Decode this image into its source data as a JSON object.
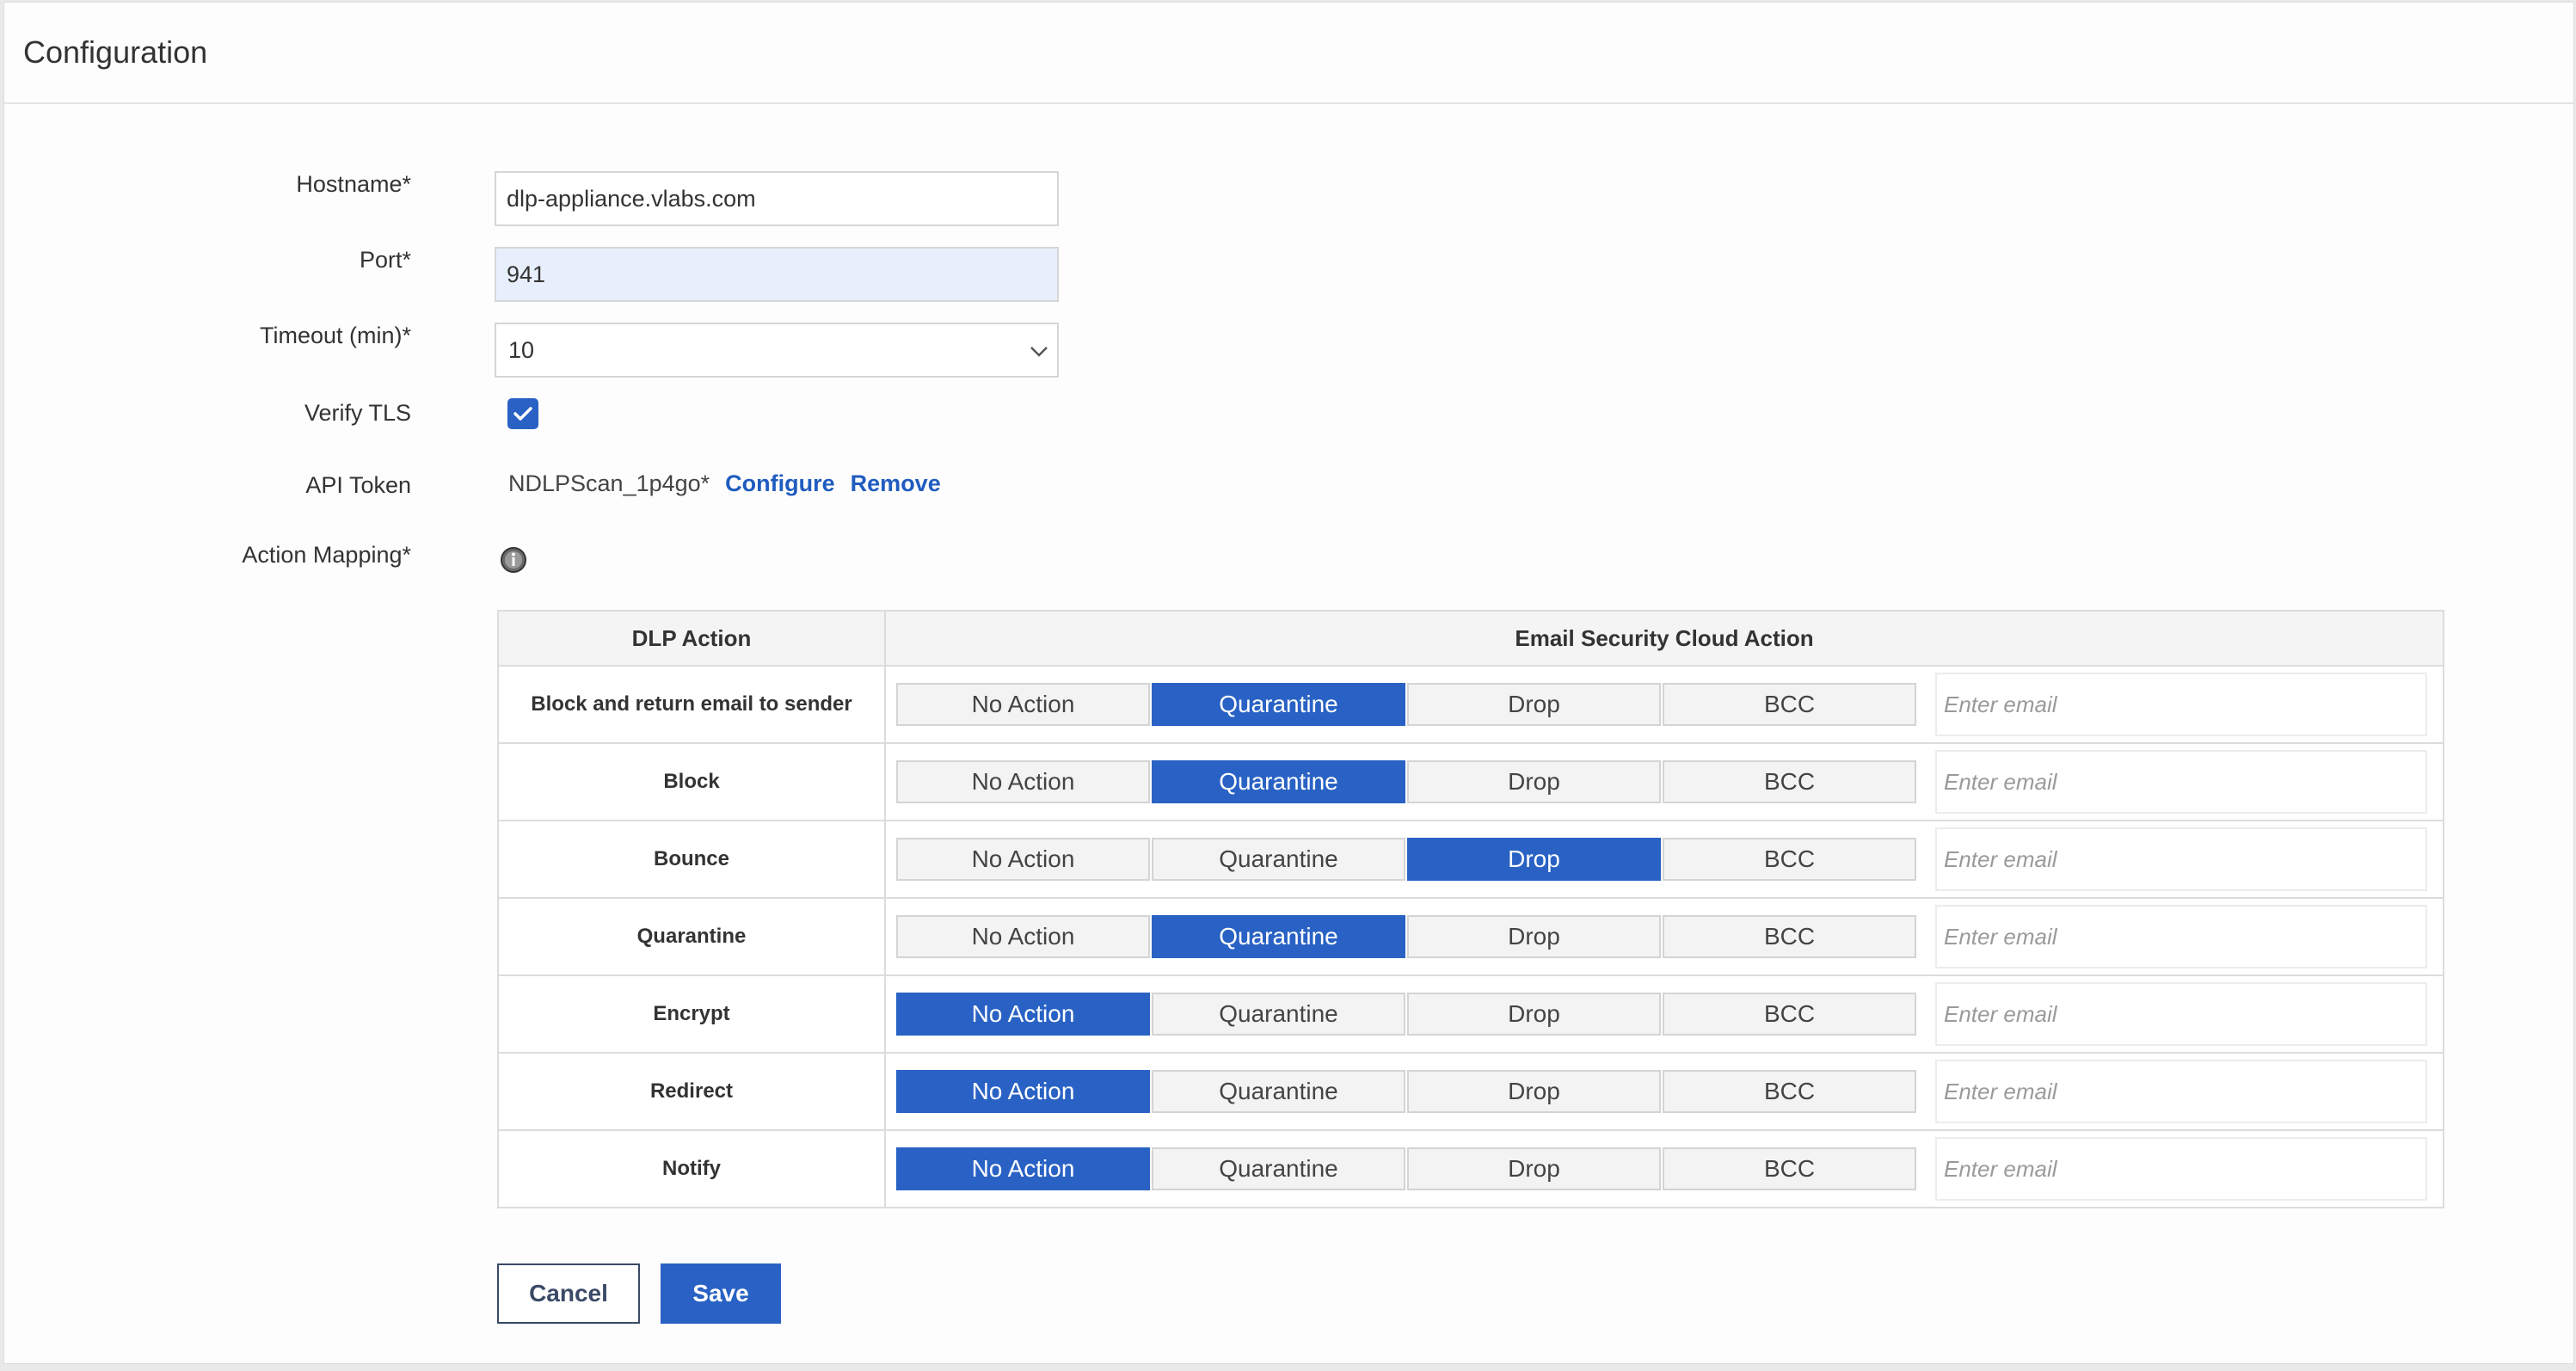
{
  "page": {
    "title": "Configuration"
  },
  "form": {
    "hostname": {
      "label": "Hostname*",
      "value": "dlp-appliance.vlabs.com"
    },
    "port": {
      "label": "Port*",
      "value": "941"
    },
    "timeout": {
      "label": "Timeout (min)*",
      "value": "10"
    },
    "verify_tls": {
      "label": "Verify TLS",
      "checked": true
    },
    "api_token": {
      "label": "API Token",
      "value": "NDLPScan_1p4go*",
      "configure_label": "Configure",
      "remove_label": "Remove"
    },
    "action_mapping": {
      "label": "Action Mapping*",
      "info_icon": "info-icon"
    }
  },
  "mapping_table": {
    "headers": {
      "dlp_action": "DLP Action",
      "cloud_action": "Email Security Cloud Action"
    },
    "options": [
      "No Action",
      "Quarantine",
      "Drop",
      "BCC"
    ],
    "email_placeholder": "Enter email",
    "rows": [
      {
        "dlp_action": "Block and return email to sender",
        "selected": "Quarantine",
        "email": ""
      },
      {
        "dlp_action": "Block",
        "selected": "Quarantine",
        "email": ""
      },
      {
        "dlp_action": "Bounce",
        "selected": "Drop",
        "email": ""
      },
      {
        "dlp_action": "Quarantine",
        "selected": "Quarantine",
        "email": ""
      },
      {
        "dlp_action": "Encrypt",
        "selected": "No Action",
        "email": ""
      },
      {
        "dlp_action": "Redirect",
        "selected": "No Action",
        "email": ""
      },
      {
        "dlp_action": "Notify",
        "selected": "No Action",
        "email": ""
      }
    ]
  },
  "buttons": {
    "cancel": "Cancel",
    "save": "Save"
  },
  "colors": {
    "accent": "#2962c4",
    "link": "#1f5cc0",
    "autofill_bg": "#e8effc"
  }
}
